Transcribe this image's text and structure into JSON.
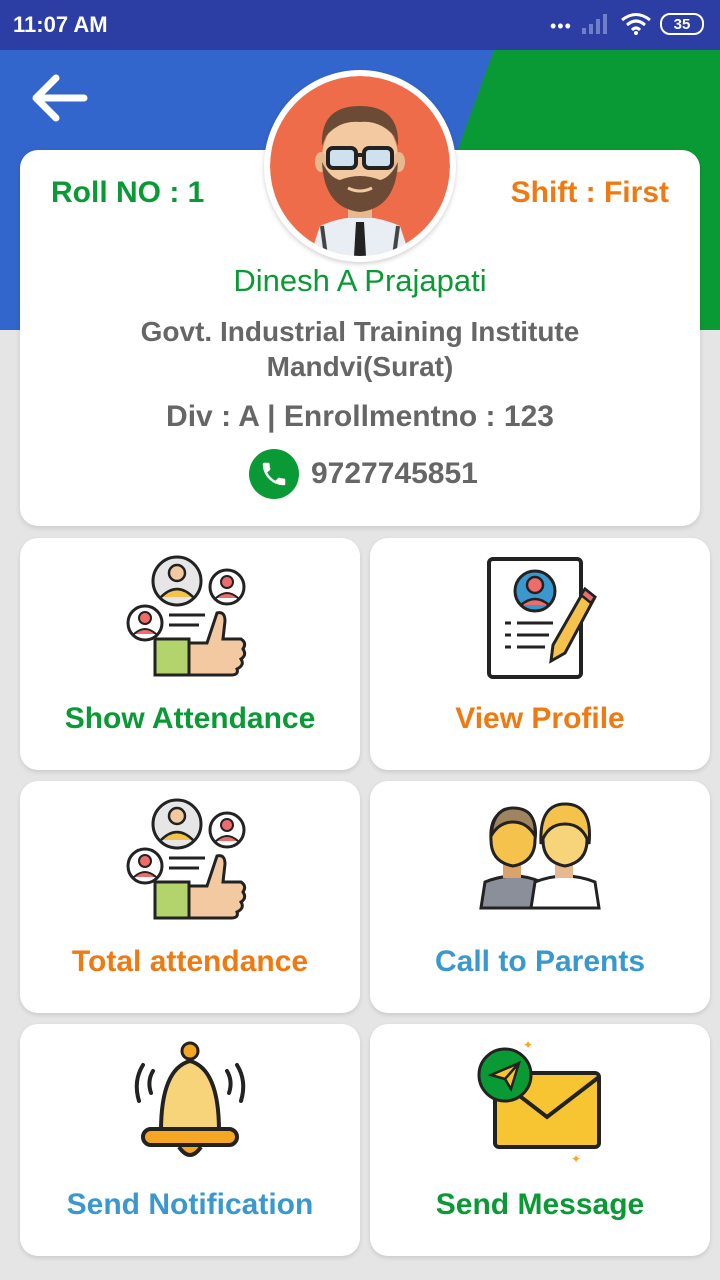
{
  "status_bar": {
    "time": "11:07 AM",
    "dots": "•••",
    "battery": "35"
  },
  "profile": {
    "roll": "Roll NO : 1",
    "shift": "Shift : First",
    "name": "Dinesh A Prajapati",
    "institute_line1": "Govt. Industrial Training Institute",
    "institute_line2": "Mandvi(Surat)",
    "div_enrollment": "Div : A | Enrollmentno : 123",
    "phone": "9727745851"
  },
  "tiles": [
    {
      "label": "Show Attendance",
      "icon": "attendance-icon",
      "color": "#0a9a35"
    },
    {
      "label": "View Profile",
      "icon": "profile-document-icon",
      "color": "#f07a12"
    },
    {
      "label": "Total attendance",
      "icon": "attendance-icon",
      "color": "#f07a12"
    },
    {
      "label": "Call to Parents",
      "icon": "parents-icon",
      "color": "#3a98cf"
    },
    {
      "label": "Send Notification",
      "icon": "bell-icon",
      "color": "#3a98cf"
    },
    {
      "label": "Send Message",
      "icon": "envelope-icon",
      "color": "#0a9a35"
    }
  ],
  "colors": {
    "header_blue": "#3366cc",
    "header_green": "#0a9a35",
    "status_bar": "#2c3da3"
  }
}
